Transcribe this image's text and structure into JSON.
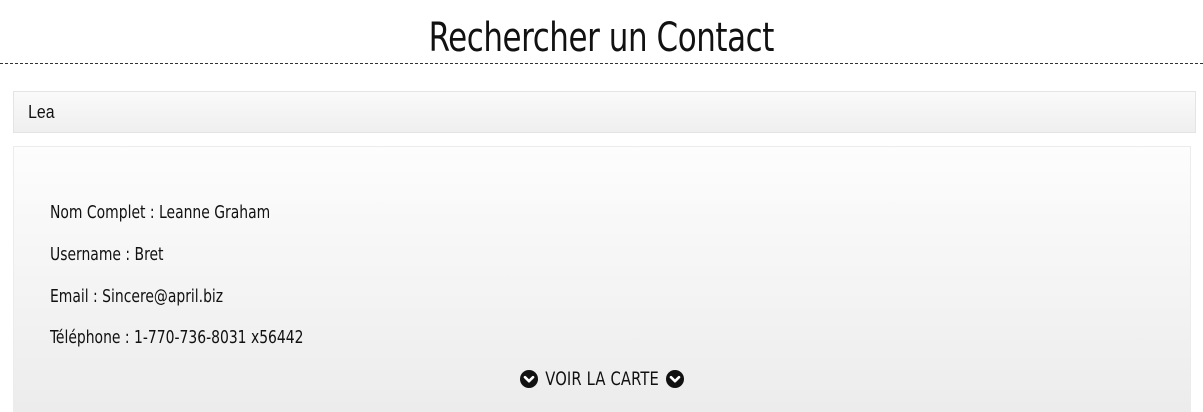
{
  "header": {
    "title": "Rechercher un Contact"
  },
  "search": {
    "value": "Lea"
  },
  "contact": {
    "full_name": "Nom Complet : Leanne Graham",
    "username": "Username : Bret",
    "email": "Email : Sincere@april.biz",
    "phone": "Téléphone : 1-770-736-8031 x56442"
  },
  "map_toggle": {
    "label": "VOIR LA CARTE",
    "icon": "chevron-circle-down-icon"
  }
}
